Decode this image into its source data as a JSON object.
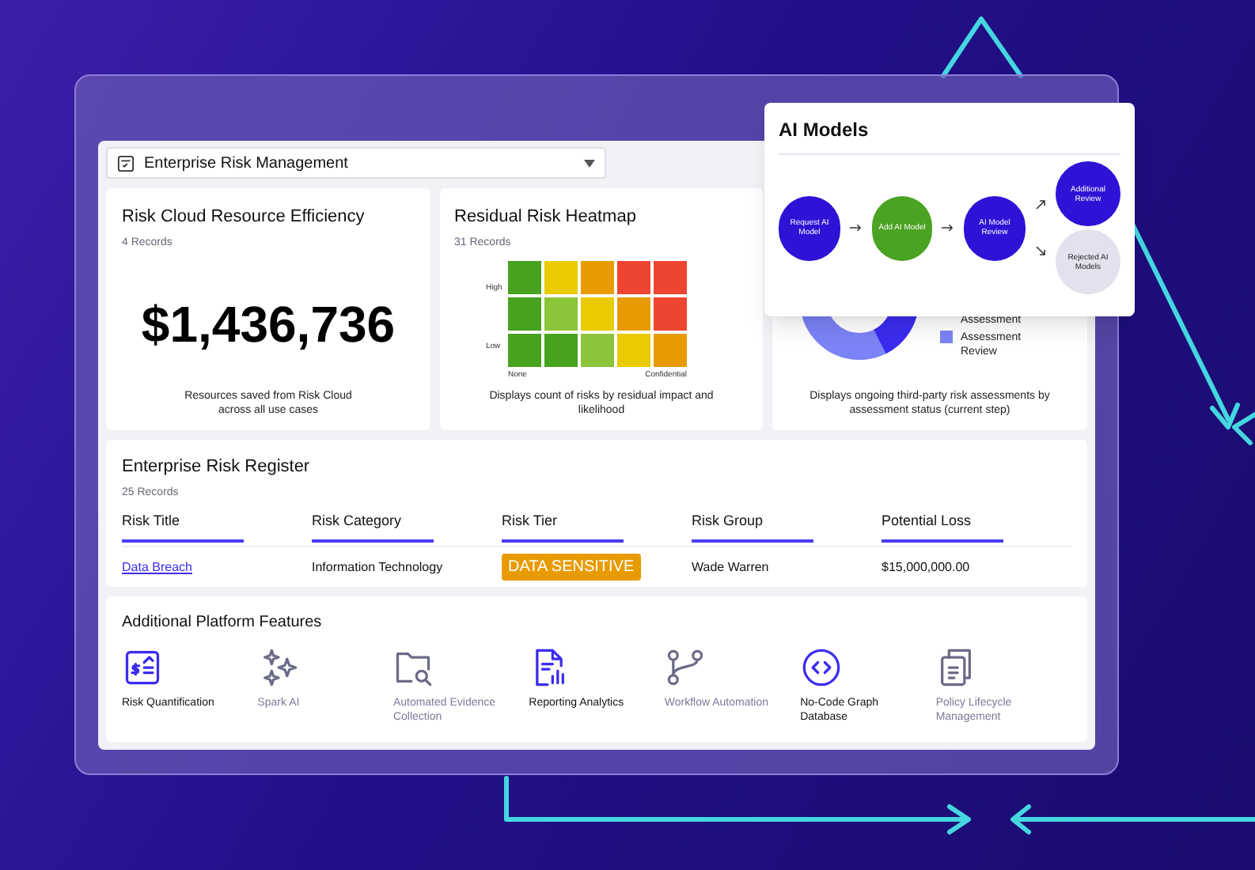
{
  "dropdown": {
    "label": "Enterprise Risk Management"
  },
  "efficiency": {
    "title": "Risk Cloud Resource Efficiency",
    "records": "4 Records",
    "value": "$1,436,736",
    "caption": "Resources saved from Risk Cloud across all use cases"
  },
  "heatmap": {
    "title": "Residual Risk Heatmap",
    "records": "31 Records",
    "y_high": "High",
    "y_low": "Low",
    "x_left": "None",
    "x_right": "Confidential",
    "rows": [
      {
        "cells": [
          {
            "color": "#46a21f"
          },
          {
            "color": "#eacb02"
          },
          {
            "color": "#e89b00"
          },
          {
            "color": "#ee4530"
          },
          {
            "color": "#ee4530"
          }
        ]
      },
      {
        "cells": [
          {
            "color": "#46a21f"
          },
          {
            "color": "#8cc43a"
          },
          {
            "color": "#eacb02"
          },
          {
            "color": "#e89b00"
          },
          {
            "color": "#ee4530"
          }
        ]
      },
      {
        "cells": [
          {
            "color": "#46a21f"
          },
          {
            "color": "#46a21f"
          },
          {
            "color": "#8cc43a"
          },
          {
            "color": "#eacb02"
          },
          {
            "color": "#e89b00"
          }
        ]
      }
    ],
    "caption": "Displays count of risks by residual impact and likelihood"
  },
  "assessments": {
    "legend": [
      {
        "label": "Assessment"
      },
      {
        "label": "Assessment Review",
        "color": "#7b83f6"
      }
    ],
    "caption": "Displays ongoing third-party risk assessments by assessment status (current step)"
  },
  "register": {
    "title": "Enterprise Risk Register",
    "records": "25 Records",
    "columns": [
      "Risk Title",
      "Risk Category",
      "Risk Tier",
      "Risk Group",
      "Potential Loss"
    ],
    "rows": [
      {
        "title": "Data Breach",
        "category": "Information Technology",
        "tier": "DATA SENSITIVE",
        "group": "Wade Warren",
        "loss": "$15,000,000.00"
      }
    ]
  },
  "features": {
    "title": "Additional Platform Features",
    "items": [
      {
        "kind": "quantification",
        "label": "Risk Quantification",
        "active": true
      },
      {
        "kind": "spark",
        "label": "Spark AI",
        "active": false
      },
      {
        "kind": "evidence",
        "label": "Automated Evidence Collection",
        "active": false
      },
      {
        "kind": "reporting",
        "label": "Reporting Analytics",
        "active": true
      },
      {
        "kind": "workflow",
        "label": "Workflow Automation",
        "active": false
      },
      {
        "kind": "graph",
        "label": "No-Code Graph Database",
        "active": true
      },
      {
        "kind": "policy",
        "label": "Policy Lifecycle Management",
        "active": false
      }
    ]
  },
  "ai_models": {
    "title": "AI Models",
    "nodes": [
      {
        "label": "Request AI Model",
        "color": "#2e12d6"
      },
      {
        "label": "Add AI Model",
        "color": "#4aa323"
      },
      {
        "label": "AI Model Review",
        "color": "#2e12d6"
      },
      {
        "label": "Additional Review",
        "color": "#2e12d6"
      },
      {
        "label": "Rejected AI Models",
        "color": "#e2e2ee"
      }
    ]
  }
}
